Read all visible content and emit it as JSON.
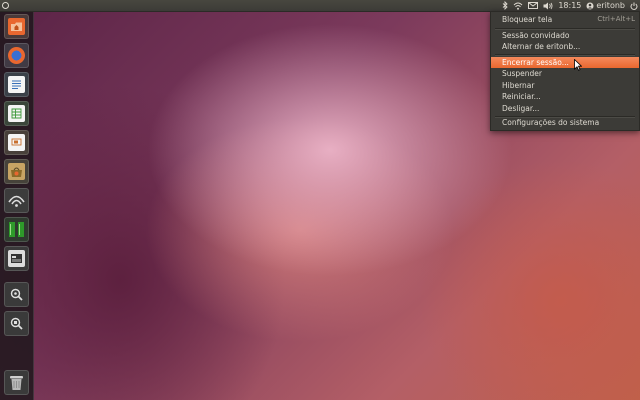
{
  "panel": {
    "time": "18:15",
    "user": "eritonb",
    "icons": [
      "bluetooth-icon",
      "wifi-icon",
      "mail-icon",
      "volume-icon",
      "user-icon",
      "power-icon"
    ]
  },
  "launcher": {
    "items": [
      {
        "name": "home-folder",
        "icon": "folder-icon",
        "color": "#e9672f"
      },
      {
        "name": "firefox",
        "icon": "firefox-icon",
        "color": "#d05a1e"
      },
      {
        "name": "writer",
        "icon": "libreoffice-writer-icon",
        "color": "#3a70b8"
      },
      {
        "name": "calc",
        "icon": "libreoffice-calc-icon",
        "color": "#3d9a3a"
      },
      {
        "name": "impress",
        "icon": "libreoffice-impress-icon",
        "color": "#c9702e"
      },
      {
        "name": "software-center",
        "icon": "software-center-icon",
        "color": "#a8884a"
      },
      {
        "name": "network",
        "icon": "network-icon",
        "color": "#9a9a96"
      },
      {
        "name": "system-monitor",
        "icon": "system-monitor-icon",
        "color": "#2e9a2a"
      },
      {
        "name": "workspaces",
        "icon": "workspace-switcher-icon",
        "color": "#8a8a86"
      },
      {
        "name": "apps-lens",
        "icon": "apps-lens-icon",
        "color": "#6e6e6a"
      },
      {
        "name": "files-lens",
        "icon": "files-lens-icon",
        "color": "#6e6e6a"
      },
      {
        "name": "trash",
        "icon": "trash-icon",
        "color": "#9a9a96"
      }
    ]
  },
  "session_menu": {
    "lock": "Bloquear tela",
    "lock_accel": "Ctrl+Alt+L",
    "guest": "Sessão convidado",
    "switch_user": "Alternar de eritonb...",
    "logout": "Encerrar sessão...",
    "suspend": "Suspender",
    "hibernate": "Hibernar",
    "restart": "Reiniciar...",
    "shutdown": "Desligar...",
    "settings": "Configurações do sistema"
  },
  "colors": {
    "panel": "#3c3b37",
    "highlight": "#e9672f",
    "text": "#dfdbd2"
  }
}
